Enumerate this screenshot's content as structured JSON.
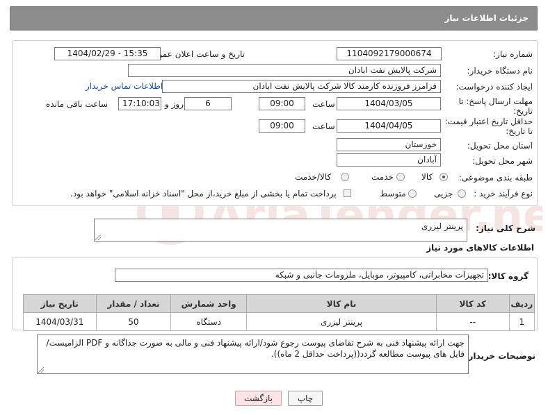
{
  "header": {
    "title": "جزئیات اطلاعات نیاز"
  },
  "form": {
    "need_number_label": "شماره نیاز:",
    "need_number": "1104092179000674",
    "announce_label": "تاریخ و ساعت اعلان عمومی:",
    "announce_value": "1404/02/29 - 15:35",
    "buyer_org_label": "نام دستگاه خریدار:",
    "buyer_org": "شرکت پالایش نفت ابادان",
    "creator_label": "ایجاد کننده درخواست:",
    "creator": "فرامرز فروزنده کارمند کالا شرکت پالایش نفت ابادان",
    "contact_link": "اطلاعات تماس خریدار",
    "deadline_label_1": "مهلت ارسال پاسخ: تا",
    "deadline_label_2": "تاریخ:",
    "deadline_date": "1404/03/05",
    "time_label": "ساعت",
    "deadline_time": "09:00",
    "days_value": "6",
    "days_label": "روز و",
    "remaining_time": "17:10:03",
    "remaining_label": "ساعت باقی مانده",
    "validity_label_1": "حداقل تاریخ اعتبار قیمت:",
    "validity_label_2": "تا تاریخ:",
    "validity_date": "1404/04/05",
    "validity_time": "09:00",
    "province_label": "استان محل تحویل:",
    "province": "خوزستان",
    "city_label": "شهر محل تحویل:",
    "city": "آبادان",
    "category_label": "طبقه بندی موضوعی:",
    "category_options": [
      "کالا",
      "خدمت",
      "کالا/خدمت"
    ],
    "category_selected": "کالا",
    "process_label": "نوع فرآیند خرید :",
    "process_options": [
      "جزیی",
      "متوسط"
    ],
    "payment_note": "پرداخت تمام یا بخشی از مبلغ خرید،از محل \"اسناد خزانه اسلامی\" خواهد بود."
  },
  "summary": {
    "label": "شرح کلی نیاز:",
    "value": "پرینتر لیزری"
  },
  "goods": {
    "section_title": "اطلاعات کالاهای مورد نیاز",
    "group_label": "گروه کالا:",
    "group_value": "تجهیزات مخابراتی، کامپیوتر، موبایل، ملزومات جانبی و شبکه",
    "columns": [
      "ردیف",
      "کد کالا",
      "نام کالا",
      "واحد شمارش",
      "تعداد / مقدار",
      "تاریخ نیاز"
    ],
    "rows": [
      [
        "1",
        "--",
        "پرینتر لیزری",
        "دستگاه",
        "50",
        "1404/03/31"
      ]
    ]
  },
  "buyer_notes": {
    "label": "توضیحات خریدار:",
    "value": "جهت ارائه پیشنهاد فنی به شرح تقاضای پیوست رجوع شود/ارائه پیشنهاد فنی و مالی به صورت جداگانه و PDF الزامیست/فایل های پیوست مطالعه گردد((پرداخت حداقل 2 ماه))."
  },
  "buttons": {
    "print": "چاپ",
    "back": "بازگشت"
  },
  "watermark": {
    "text": "AriaTender.net"
  },
  "colors": {
    "header": "#8c8c8c",
    "link": "#1a4ea8",
    "back_button": "#fde4e4",
    "watermark": "#c0392b"
  }
}
